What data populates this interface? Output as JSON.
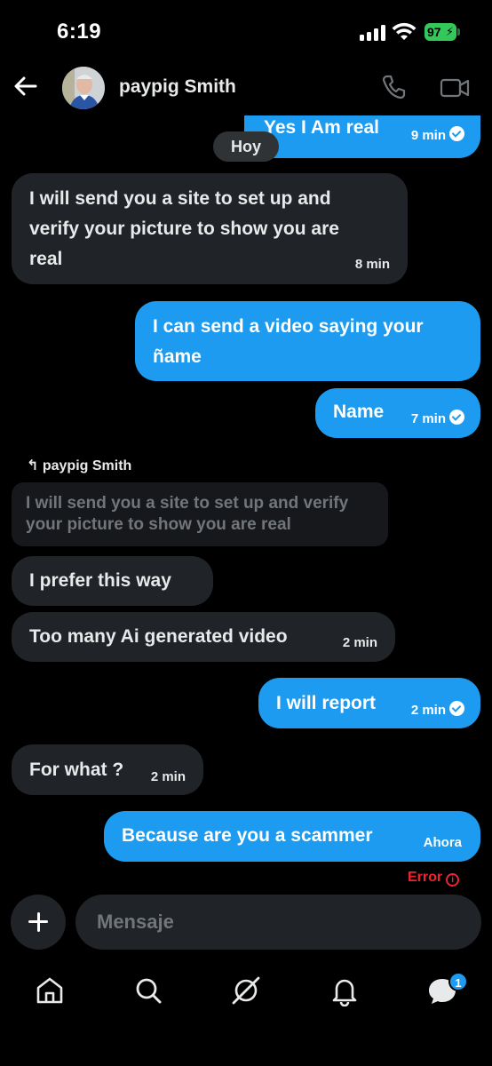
{
  "status_bar": {
    "time": "6:19",
    "battery": "97"
  },
  "header": {
    "contact_name": "paypig Smith"
  },
  "day_separator": "Hoy",
  "messages": [
    {
      "dir": "out",
      "text": "Yes I Am real",
      "time": "9 min"
    },
    {
      "dir": "in",
      "lines": [
        "I will send you a site to set up and",
        "verify your picture to show you are",
        "real"
      ],
      "time": "8 min"
    },
    {
      "dir": "out",
      "lines": [
        "I can send a video saying your",
        "ñame"
      ]
    },
    {
      "dir": "out",
      "text": "Name",
      "time": "7 min"
    },
    {
      "dir": "in",
      "reply_to": "paypig Smith",
      "quoted_lines": [
        "I will send you a site to set up and verify",
        "your picture to show you are real"
      ]
    },
    {
      "dir": "in",
      "text": "I prefer this way"
    },
    {
      "dir": "in",
      "text": "Too many Ai generated video",
      "time": "2 min"
    },
    {
      "dir": "out",
      "text": "I will report",
      "time": "2 min"
    },
    {
      "dir": "in",
      "text": "For what ?",
      "time": "2 min"
    },
    {
      "dir": "out",
      "text": "Because are you a scammer",
      "time": "Ahora",
      "status": "Error"
    }
  ],
  "composer": {
    "placeholder": "Mensaje"
  },
  "nav": {
    "items": [
      "home-icon",
      "search-icon",
      "grok-icon",
      "notifications-icon",
      "messages-icon"
    ],
    "messages_badge": "1"
  },
  "colors": {
    "accent": "#1d9bf0",
    "incoming": "#202327",
    "error": "#f4212e",
    "background": "#000000"
  }
}
